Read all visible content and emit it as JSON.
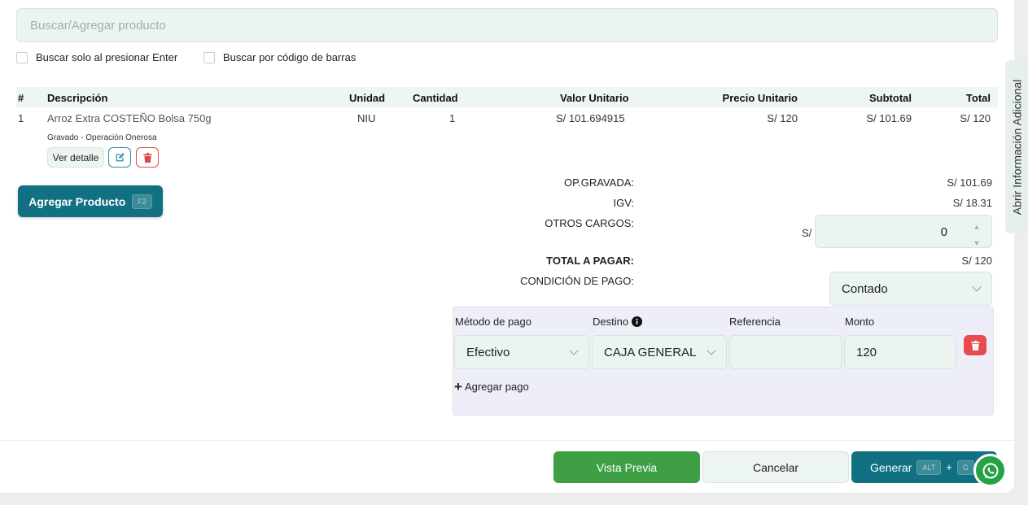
{
  "search": {
    "placeholder": "Buscar/Agregar producto"
  },
  "options": {
    "enter_only": "Buscar solo al presionar Enter",
    "barcode": "Buscar por código de barras"
  },
  "table": {
    "headers": {
      "num": "#",
      "desc": "Descripción",
      "unit": "Unidad",
      "qty": "Cantidad",
      "unit_value": "Valor Unitario",
      "unit_price": "Precio Unitario",
      "subtotal": "Subtotal",
      "total": "Total"
    },
    "rows": [
      {
        "num": "1",
        "desc": "Arroz Extra COSTEÑO Bolsa 750g",
        "note": "Gravado - Operación Onerosa",
        "unit": "NIU",
        "qty": "1",
        "unit_value": "S/ 101.694915",
        "unit_price": "S/ 120",
        "subtotal": "S/ 101.69",
        "total": "S/ 120"
      }
    ],
    "detail_label": "Ver detalle"
  },
  "add_product": {
    "label": "Agregar Producto",
    "shortcut": "F2"
  },
  "summary": {
    "op_gravada_label": "OP.GRAVADA:",
    "op_gravada": "S/ 101.69",
    "igv_label": "IGV:",
    "igv": "S/ 18.31",
    "otros_label": "OTROS CARGOS:",
    "otros_prefix": "S/",
    "otros_value": "0",
    "total_label": "TOTAL A PAGAR:",
    "total": "S/ 120",
    "condicion_label": "CONDICIÓN DE PAGO:",
    "condicion_value": "Contado"
  },
  "payment": {
    "headers": {
      "method": "Método de pago",
      "dest": "Destino",
      "ref": "Referencia",
      "amount": "Monto"
    },
    "method": "Efectivo",
    "dest": "CAJA GENERAL",
    "ref": "",
    "amount": "120",
    "add_label": "Agregar pago"
  },
  "footer": {
    "preview": "Vista Previa",
    "cancel": "Cancelar",
    "generate": "Generar",
    "kbd_alt": "ALT",
    "kbd_plus": "+",
    "kbd_g": "G"
  },
  "sidebar": {
    "label": "Abrir Información Adicional"
  },
  "colors": {
    "primary": "#117183",
    "success": "#3e9f45",
    "danger": "#e04848",
    "whatsapp": "#25a244"
  }
}
